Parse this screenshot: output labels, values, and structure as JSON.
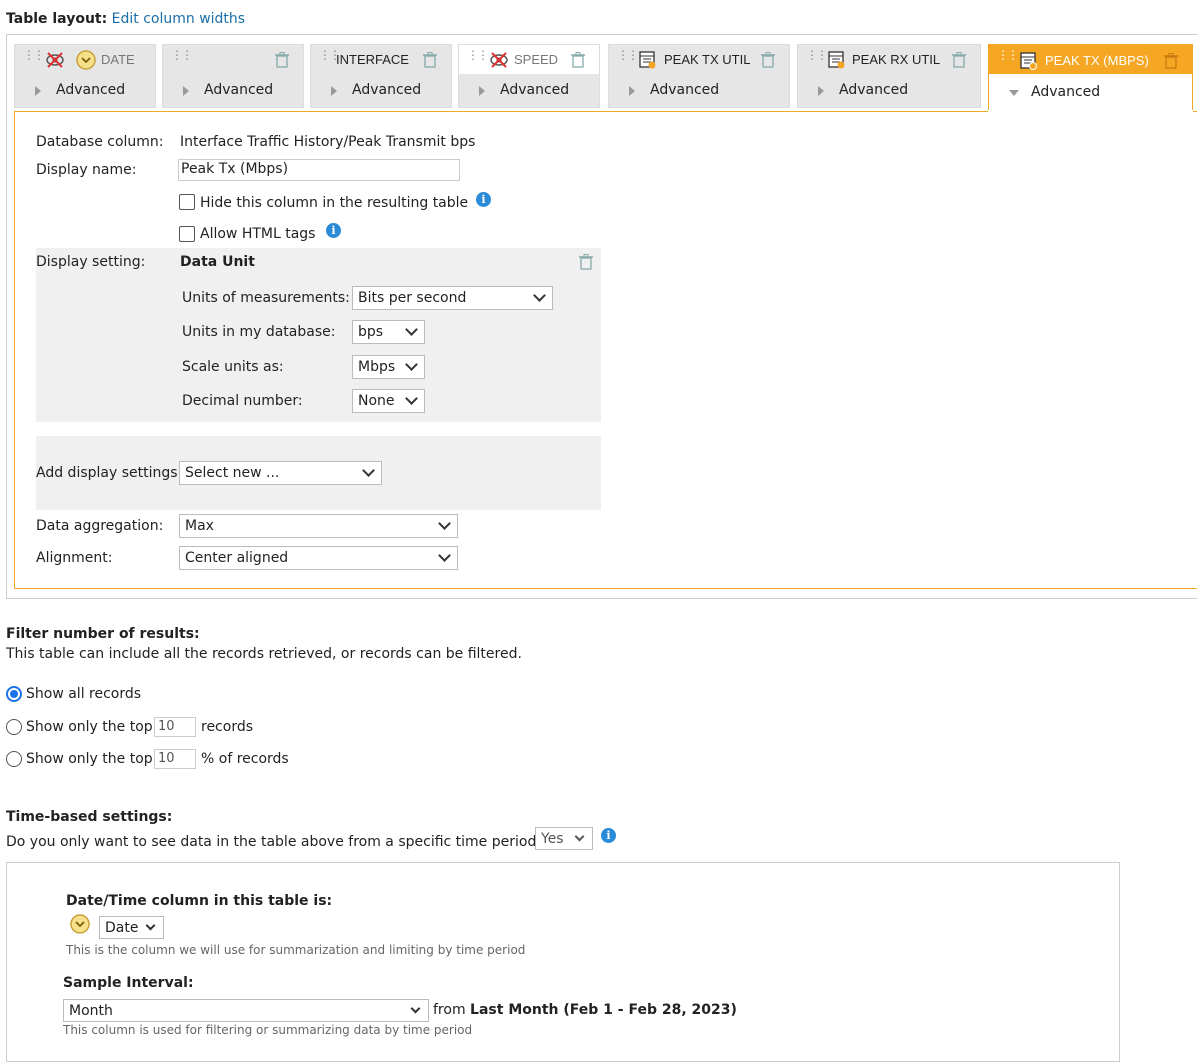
{
  "header": {
    "label": "Table layout:",
    "edit_link": "Edit column widths"
  },
  "columns": [
    {
      "title": "DATE",
      "advanced": "Advanced"
    },
    {
      "title": "",
      "advanced": "Advanced"
    },
    {
      "title": "INTERFACE",
      "advanced": "Advanced"
    },
    {
      "title": "SPEED",
      "advanced": "Advanced"
    },
    {
      "title": "PEAK TX UTIL",
      "advanced": "Advanced"
    },
    {
      "title": "PEAK RX UTIL",
      "advanced": "Advanced"
    },
    {
      "title": "PEAK TX (MBPS)",
      "advanced": "Advanced"
    }
  ],
  "detail": {
    "db_column_label": "Database column:",
    "db_column_value": "Interface Traffic History/Peak Transmit bps",
    "display_name_label": "Display name:",
    "display_name_value": "Peak Tx (Mbps)",
    "hide_label": "Hide this column in the resulting table",
    "html_label": "Allow HTML tags",
    "display_setting_label": "Display setting:",
    "data_unit_title": "Data Unit",
    "units_measure_label": "Units of measurements:",
    "units_measure_value": "Bits per second",
    "units_db_label": "Units in my database:",
    "units_db_value": "bps",
    "scale_label": "Scale units as:",
    "scale_value": "Mbps",
    "decimal_label": "Decimal number:",
    "decimal_value": "None",
    "add_display_label": "Add display settings:",
    "add_display_value": "Select new ...",
    "aggregation_label": "Data aggregation:",
    "aggregation_value": "Max",
    "alignment_label": "Alignment:",
    "alignment_value": "Center aligned"
  },
  "filter": {
    "title": "Filter number of results:",
    "desc": "This table can include all the records retrieved, or records can be filtered.",
    "opt_all": "Show all records",
    "opt_top_prefix": "Show only the top",
    "opt_top_value": "10",
    "opt_top_suffix": "records",
    "opt_pct_prefix": "Show only the top",
    "opt_pct_value": "10",
    "opt_pct_suffix": "% of records"
  },
  "time": {
    "title": "Time-based settings:",
    "question": "Do you only want to see data in the table above from a specific time period?",
    "answer": "Yes",
    "dt_column_title": "Date/Time column in this table is:",
    "dt_column_value": "Date",
    "dt_column_hint": "This is the column we will use for summarization and limiting by time period",
    "sample_title": "Sample Interval:",
    "sample_value": "Month",
    "from_label": "from",
    "from_value": "Last Month (Feb 1 - Feb 28, 2023)",
    "sample_hint": "This column is used for filtering or summarizing data by time period"
  },
  "colors": {
    "accent": "#f5a623",
    "info": "#2a8bd8",
    "link": "#1a6fa8"
  }
}
